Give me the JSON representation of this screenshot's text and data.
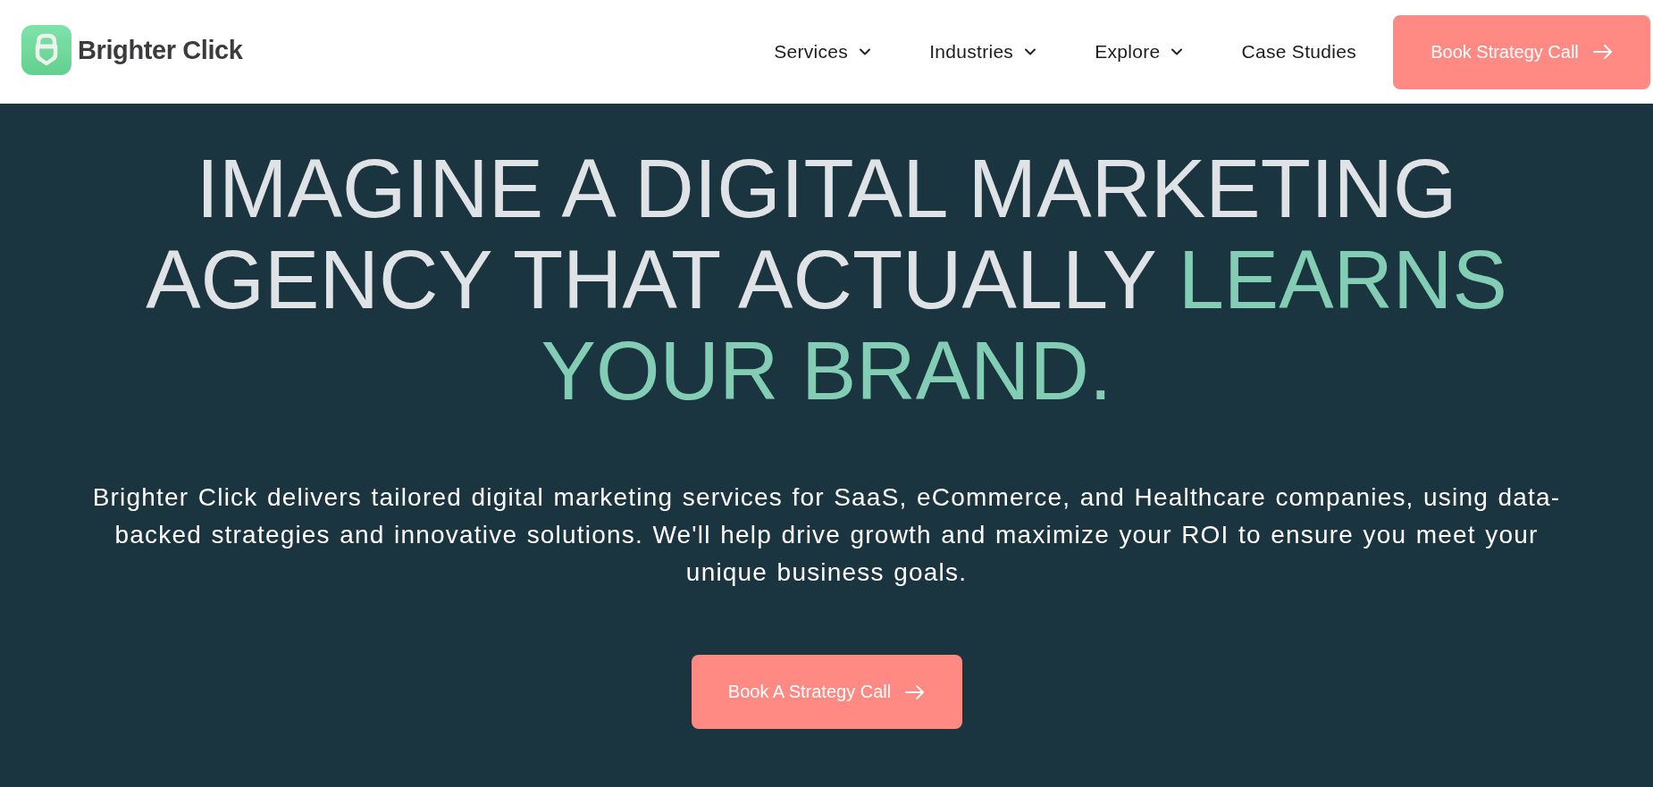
{
  "header": {
    "logo": {
      "text": "Brighter Click"
    },
    "nav": [
      {
        "label": "Services",
        "dropdown": true
      },
      {
        "label": "Industries",
        "dropdown": true
      },
      {
        "label": "Explore",
        "dropdown": true
      },
      {
        "label": "Case Studies",
        "dropdown": false
      }
    ],
    "cta_button": {
      "label": "Book Strategy Call"
    }
  },
  "hero": {
    "headline": [
      {
        "text": "IMAGINE A DIGITAL MARKETING AGENCY THAT ACTUALLY",
        "highlight": false
      },
      {
        "text": "LEARNS YOUR BRAND.",
        "highlight": true
      }
    ],
    "description": "Brighter Click delivers tailored digital marketing services for SaaS, eCommerce, and Healthcare companies, using data-backed strategies and innovative solutions. We'll help drive growth and maximize your ROI to ensure you meet your\nunique business goals.",
    "button": {
      "label": "Book A Strategy Call"
    }
  }
}
